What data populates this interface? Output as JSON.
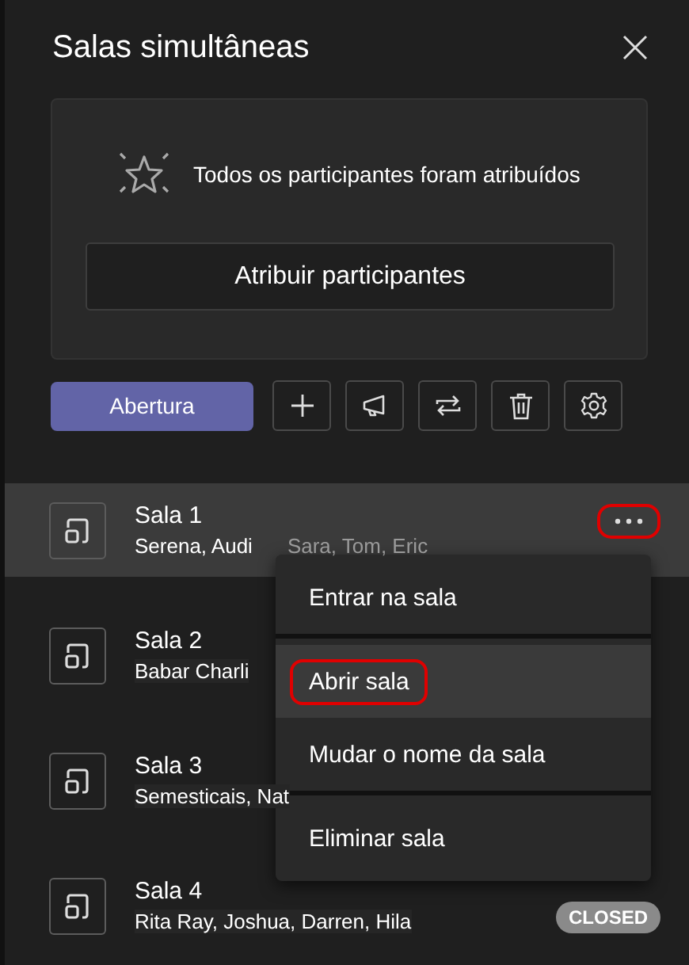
{
  "panel": {
    "title": "Salas simultâneas"
  },
  "assign_card": {
    "message": "Todos os participantes foram atribuídos",
    "button": "Atribuir participantes"
  },
  "toolbar": {
    "primary_button": "Abertura"
  },
  "rooms": [
    {
      "name": "Sala 1",
      "participants": "Serena, Audi",
      "extra_participants": "Sara, Tom, Eric",
      "selected": true,
      "more_highlighted": true
    },
    {
      "name": "Sala 2",
      "participants": "Babar Charli",
      "selected": false
    },
    {
      "name": "Sala 3",
      "participants": "Semesticais, Nat",
      "selected": false
    },
    {
      "name": "Sala 4",
      "participants": "Rita Ray, Joshua, Darren, Hila",
      "status": "CLOSED",
      "selected": false
    }
  ],
  "context_menu": {
    "items": [
      {
        "label": "Entrar na sala",
        "selected": false,
        "highlighted": false,
        "divider_after": true
      },
      {
        "label": "Abrir sala",
        "selected": true,
        "highlighted": true,
        "divider_after": false
      },
      {
        "label": "Mudar o nome da sala",
        "selected": false,
        "highlighted": false,
        "divider_after": true
      },
      {
        "label": "Eliminar sala",
        "selected": false,
        "highlighted": false,
        "divider_after": false
      }
    ]
  }
}
